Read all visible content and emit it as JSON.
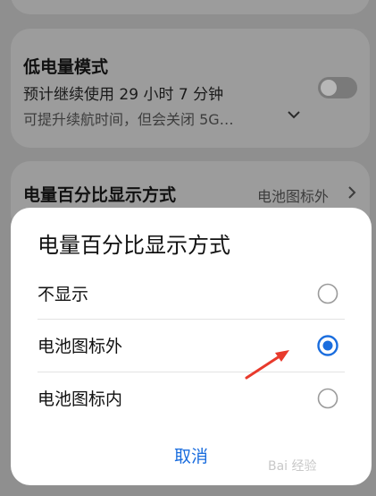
{
  "low_power": {
    "title": "低电量模式",
    "subtitle": "预计继续使用 29 小时 7 分钟",
    "description": "可提升续航时间，但会关闭 5G…",
    "enabled": false
  },
  "battery_percentage": {
    "title": "电量百分比显示方式",
    "value": "电池图标外"
  },
  "dialog": {
    "title": "电量百分比显示方式",
    "options": [
      {
        "label": "不显示",
        "selected": false
      },
      {
        "label": "电池图标外",
        "selected": true
      },
      {
        "label": "电池图标内",
        "selected": false
      }
    ],
    "cancel_label": "取消"
  },
  "colors": {
    "accent": "#1a6dde",
    "annotation_arrow": "#e83a2c"
  },
  "watermark": {
    "text": "Bai 经验"
  }
}
